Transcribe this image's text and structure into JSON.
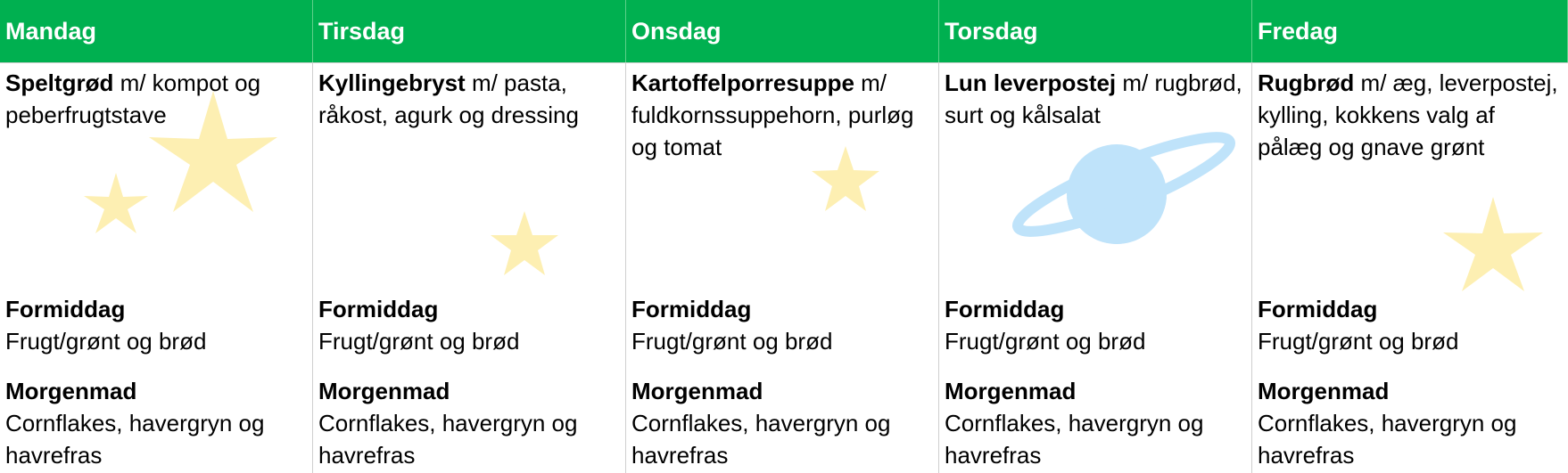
{
  "colors": {
    "header_bg": "#00b050",
    "header_text": "#ffffff",
    "star": "#fdefb2",
    "planet": "#bfe3fa"
  },
  "days": [
    {
      "name": "Mandag",
      "lunch_bold": "Speltgrød",
      "lunch_rest": " m/ kompot og peberfrugtstave",
      "snack_title": "Formiddag",
      "snack_text": "Frugt/grønt og brød",
      "breakfast_title": "Morgenmad",
      "breakfast_text": "Cornflakes, havergryn og havrefras",
      "decorations": [
        "star-icon",
        "star-icon"
      ]
    },
    {
      "name": "Tirsdag",
      "lunch_bold": "Kyllingebryst",
      "lunch_rest": " m/ pasta, råkost, agurk og dressing",
      "snack_title": "Formiddag",
      "snack_text": "Frugt/grønt og brød",
      "breakfast_title": "Morgenmad",
      "breakfast_text": "Cornflakes, havergryn og havrefras",
      "decorations": [
        "star-icon"
      ]
    },
    {
      "name": "Onsdag",
      "lunch_bold": "Kartoffelporresuppe",
      "lunch_rest": " m/ fuldkornssuppehorn, purløg og tomat",
      "snack_title": "Formiddag",
      "snack_text": "Frugt/grønt og brød",
      "breakfast_title": "Morgenmad",
      "breakfast_text": "Cornflakes, havergryn og havrefras",
      "decorations": [
        "star-icon"
      ]
    },
    {
      "name": "Torsdag",
      "lunch_bold": "Lun leverpostej",
      "lunch_rest": " m/ rugbrød, surt og kålsalat",
      "snack_title": "Formiddag",
      "snack_text": "Frugt/grønt og brød",
      "breakfast_title": "Morgenmad",
      "breakfast_text": "Cornflakes, havergryn og havrefras",
      "decorations": [
        "planet-icon"
      ]
    },
    {
      "name": "Fredag",
      "lunch_bold": "Rugbrød",
      "lunch_rest": " m/ æg, leverpostej, kylling, kokkens valg af pålæg og gnave grønt",
      "snack_title": "Formiddag",
      "snack_text": "Frugt/grønt og brød",
      "breakfast_title": "Morgenmad",
      "breakfast_text": "Cornflakes, havergryn og havrefras",
      "decorations": [
        "star-icon"
      ]
    }
  ]
}
